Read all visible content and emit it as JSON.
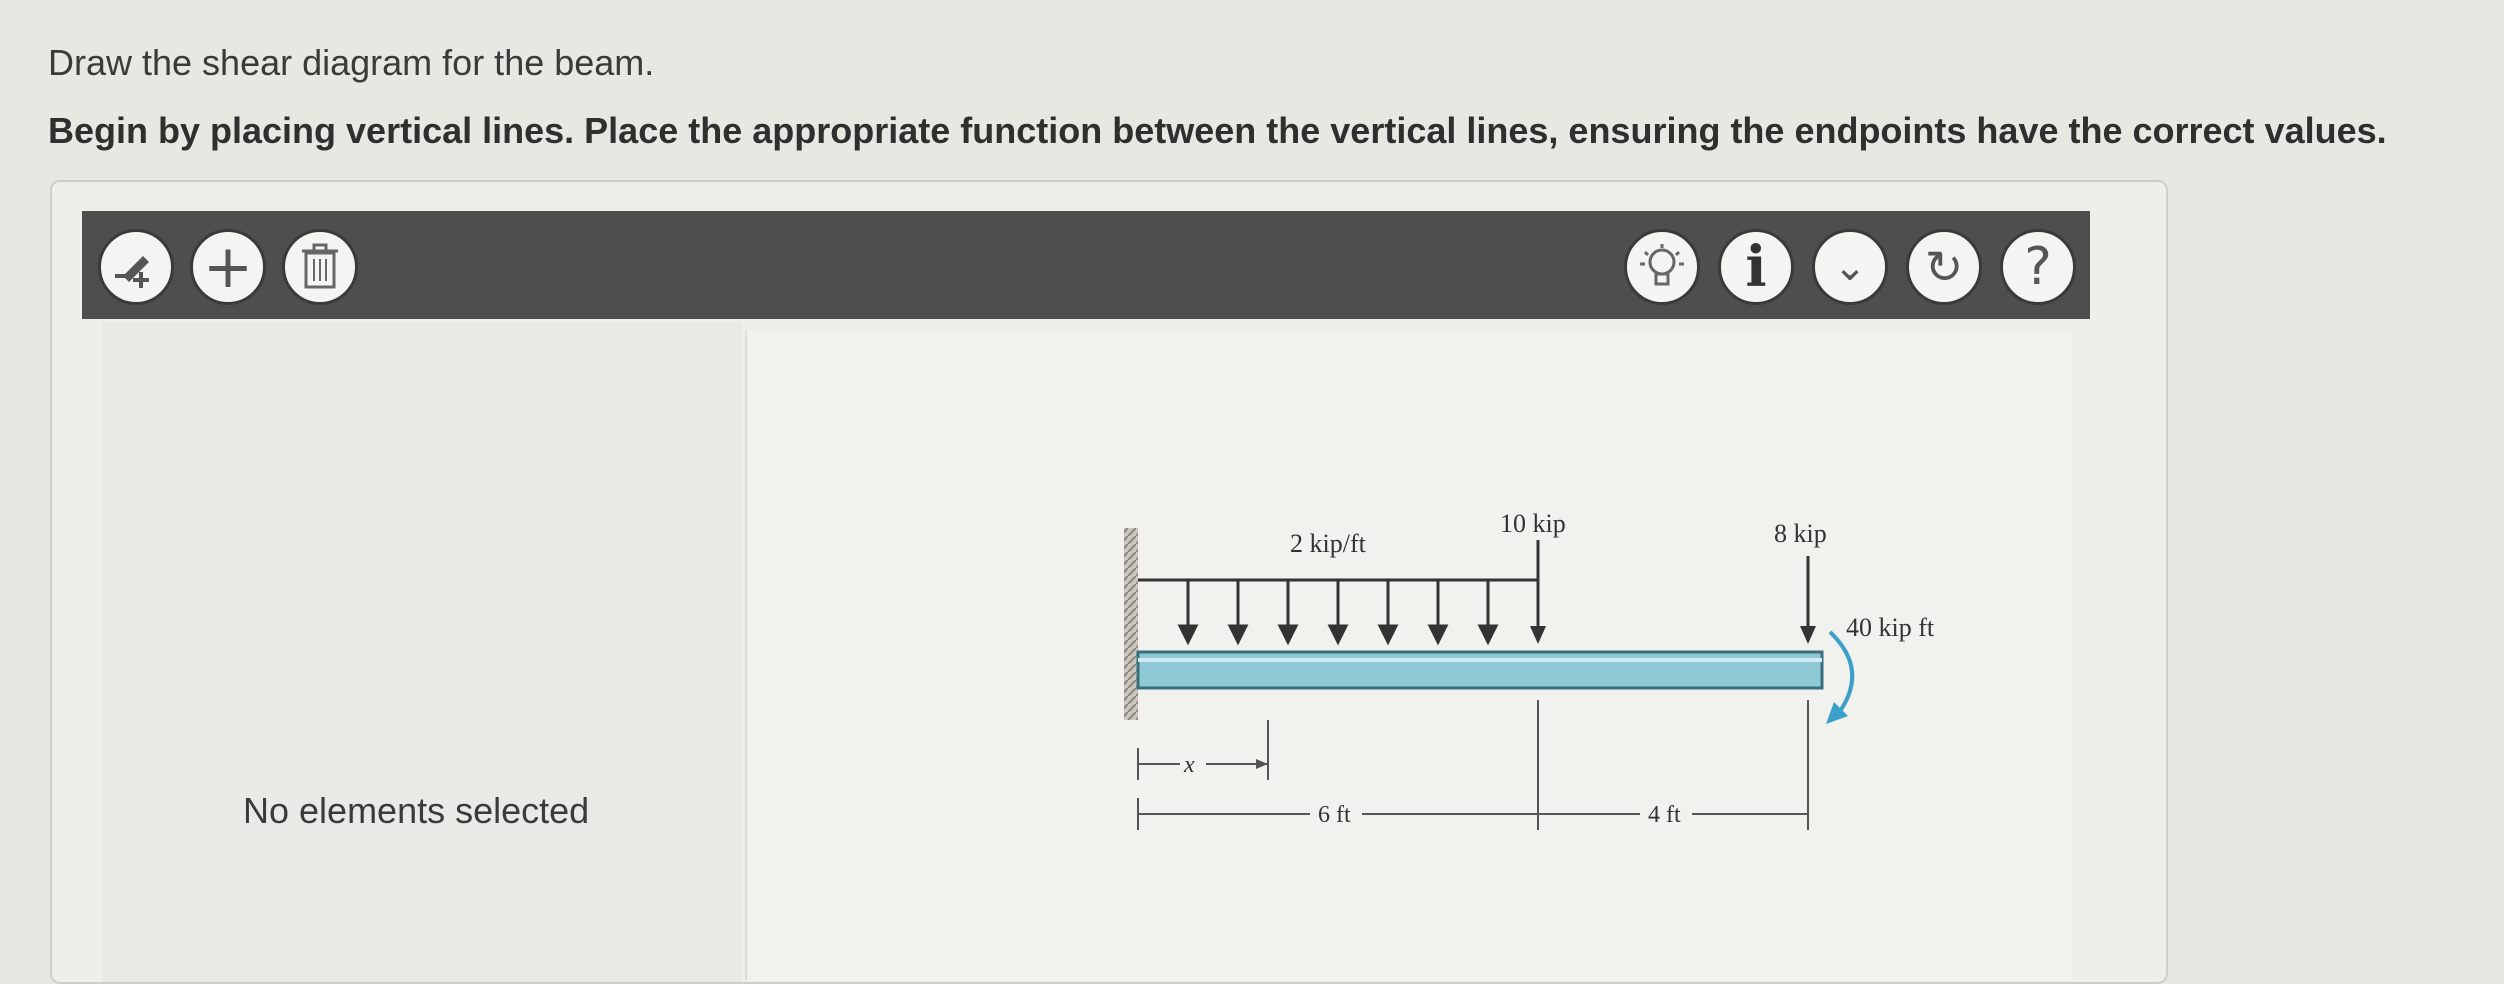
{
  "instructions": {
    "line1": "Draw the shear diagram for the beam.",
    "line2": "Begin by placing vertical lines. Place the appropriate function between the vertical lines, ensuring the endpoints have the correct values."
  },
  "toolbar": {
    "left_tools": [
      {
        "name": "vertical-line-tool",
        "icon": "pencil-plus-icon"
      },
      {
        "name": "add-tool",
        "icon": "plus-icon",
        "glyph": "+"
      },
      {
        "name": "delete-tool",
        "icon": "trash-icon"
      }
    ],
    "right_tools": [
      {
        "name": "hint",
        "icon": "lightbulb-icon"
      },
      {
        "name": "info",
        "icon": "info-icon",
        "glyph": "i"
      },
      {
        "name": "expand",
        "icon": "chevron-down-icon",
        "glyph": "⌄"
      },
      {
        "name": "reset",
        "icon": "redo-icon",
        "glyph": "↻"
      },
      {
        "name": "help",
        "icon": "help-icon",
        "glyph": "?"
      }
    ]
  },
  "status": "No elements selected",
  "figure": {
    "distributed_load": "2 kip/ft",
    "point_load_1": "10 kip",
    "point_load_2": "8 kip",
    "moment": "40 kip ft",
    "x_label": "x",
    "dim_1": "6 ft",
    "dim_2": "4 ft"
  },
  "colors": {
    "toolbar": "#4e4e4e",
    "beam": "#8fc9d6",
    "moment_arrow": "#3a9fc9"
  }
}
